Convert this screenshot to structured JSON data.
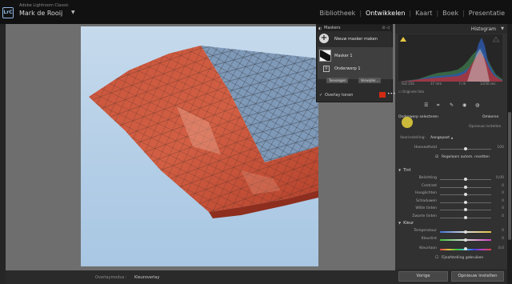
{
  "app": {
    "subtitle": "Adobe Lightroom Classic",
    "user": "Mark de Rooij",
    "logo_text": "LrC"
  },
  "modules": [
    {
      "label": "Bibliotheek",
      "active": false
    },
    {
      "label": "Ontwikkelen",
      "active": true
    },
    {
      "label": "Kaart",
      "active": false
    },
    {
      "label": "Boek",
      "active": false
    },
    {
      "label": "Presentatie",
      "active": false
    }
  ],
  "masks_panel": {
    "title": "Maskers",
    "new_mask_label": "Nieuw masker maken",
    "mask_name": "Masker 1",
    "component_name": "Onderwerp 1",
    "add_label": "Toevoegen",
    "subtract_label": "Verwijder...",
    "overlay_label": "Overlay tonen",
    "overlay_color": "#d22a12"
  },
  "histogram": {
    "title": "Histogram",
    "iso": "ISO 250",
    "focal": "37 mm",
    "aperture": "f / 8",
    "shutter": "1/250 sec",
    "original_photo": "Originele foto"
  },
  "selection": {
    "label": "Onderwerp selecteren",
    "invert": "Omkeren",
    "amount_reset": "Opnieuw instellen"
  },
  "preset": {
    "label": "Voorinstelling:",
    "value": "Aangepast",
    "amount_label": "Hoeveelheid",
    "amount_value": "100",
    "autoreset_label": "Regelaars autom. resetten"
  },
  "sections": {
    "tone": "Tint",
    "color": "Kleur"
  },
  "tone_sliders": [
    {
      "label": "Belichting",
      "value": "0,00",
      "pos": 0.5
    },
    {
      "label": "Contrast",
      "value": "0",
      "pos": 0.5
    },
    {
      "label": "Hooglichten",
      "value": "0",
      "pos": 0.5
    },
    {
      "label": "Schaduwen",
      "value": "0",
      "pos": 0.5
    },
    {
      "label": "Witte tinten",
      "value": "0",
      "pos": 0.5
    },
    {
      "label": "Zwarte tinten",
      "value": "0",
      "pos": 0.5
    }
  ],
  "color_sliders": [
    {
      "label": "Temperatuur",
      "value": "0",
      "pos": 0.5
    },
    {
      "label": "Kleurtint",
      "value": "0",
      "pos": 0.5
    }
  ],
  "hue": {
    "label": "Kleurtoon",
    "value": "0,0",
    "fine_label": "Fijnafstelling gebruiken"
  },
  "footer": {
    "overlay_mode_label": "Overlaymodus :",
    "overlay_mode_value": "Kleuroverlay",
    "prev_button": "Vorige",
    "reset_button": "Opnieuw instellen"
  }
}
